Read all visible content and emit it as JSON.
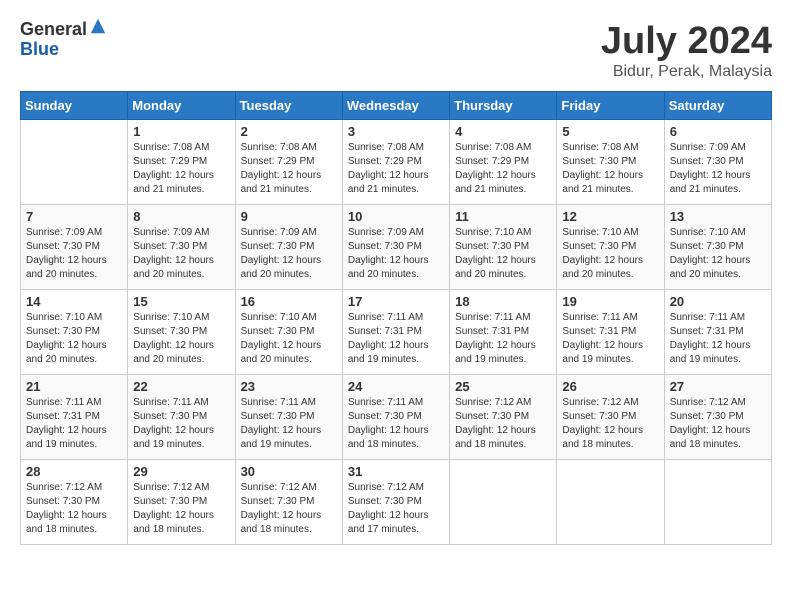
{
  "header": {
    "logo": {
      "general": "General",
      "blue": "Blue"
    },
    "title": "July 2024",
    "subtitle": "Bidur, Perak, Malaysia"
  },
  "calendar": {
    "weekdays": [
      "Sunday",
      "Monday",
      "Tuesday",
      "Wednesday",
      "Thursday",
      "Friday",
      "Saturday"
    ],
    "weeks": [
      [
        {
          "day": "",
          "info": ""
        },
        {
          "day": "1",
          "info": "Sunrise: 7:08 AM\nSunset: 7:29 PM\nDaylight: 12 hours\nand 21 minutes."
        },
        {
          "day": "2",
          "info": "Sunrise: 7:08 AM\nSunset: 7:29 PM\nDaylight: 12 hours\nand 21 minutes."
        },
        {
          "day": "3",
          "info": "Sunrise: 7:08 AM\nSunset: 7:29 PM\nDaylight: 12 hours\nand 21 minutes."
        },
        {
          "day": "4",
          "info": "Sunrise: 7:08 AM\nSunset: 7:29 PM\nDaylight: 12 hours\nand 21 minutes."
        },
        {
          "day": "5",
          "info": "Sunrise: 7:08 AM\nSunset: 7:30 PM\nDaylight: 12 hours\nand 21 minutes."
        },
        {
          "day": "6",
          "info": "Sunrise: 7:09 AM\nSunset: 7:30 PM\nDaylight: 12 hours\nand 21 minutes."
        }
      ],
      [
        {
          "day": "7",
          "info": "Sunrise: 7:09 AM\nSunset: 7:30 PM\nDaylight: 12 hours\nand 20 minutes."
        },
        {
          "day": "8",
          "info": "Sunrise: 7:09 AM\nSunset: 7:30 PM\nDaylight: 12 hours\nand 20 minutes."
        },
        {
          "day": "9",
          "info": "Sunrise: 7:09 AM\nSunset: 7:30 PM\nDaylight: 12 hours\nand 20 minutes."
        },
        {
          "day": "10",
          "info": "Sunrise: 7:09 AM\nSunset: 7:30 PM\nDaylight: 12 hours\nand 20 minutes."
        },
        {
          "day": "11",
          "info": "Sunrise: 7:10 AM\nSunset: 7:30 PM\nDaylight: 12 hours\nand 20 minutes."
        },
        {
          "day": "12",
          "info": "Sunrise: 7:10 AM\nSunset: 7:30 PM\nDaylight: 12 hours\nand 20 minutes."
        },
        {
          "day": "13",
          "info": "Sunrise: 7:10 AM\nSunset: 7:30 PM\nDaylight: 12 hours\nand 20 minutes."
        }
      ],
      [
        {
          "day": "14",
          "info": "Sunrise: 7:10 AM\nSunset: 7:30 PM\nDaylight: 12 hours\nand 20 minutes."
        },
        {
          "day": "15",
          "info": "Sunrise: 7:10 AM\nSunset: 7:30 PM\nDaylight: 12 hours\nand 20 minutes."
        },
        {
          "day": "16",
          "info": "Sunrise: 7:10 AM\nSunset: 7:30 PM\nDaylight: 12 hours\nand 20 minutes."
        },
        {
          "day": "17",
          "info": "Sunrise: 7:11 AM\nSunset: 7:31 PM\nDaylight: 12 hours\nand 19 minutes."
        },
        {
          "day": "18",
          "info": "Sunrise: 7:11 AM\nSunset: 7:31 PM\nDaylight: 12 hours\nand 19 minutes."
        },
        {
          "day": "19",
          "info": "Sunrise: 7:11 AM\nSunset: 7:31 PM\nDaylight: 12 hours\nand 19 minutes."
        },
        {
          "day": "20",
          "info": "Sunrise: 7:11 AM\nSunset: 7:31 PM\nDaylight: 12 hours\nand 19 minutes."
        }
      ],
      [
        {
          "day": "21",
          "info": "Sunrise: 7:11 AM\nSunset: 7:31 PM\nDaylight: 12 hours\nand 19 minutes."
        },
        {
          "day": "22",
          "info": "Sunrise: 7:11 AM\nSunset: 7:30 PM\nDaylight: 12 hours\nand 19 minutes."
        },
        {
          "day": "23",
          "info": "Sunrise: 7:11 AM\nSunset: 7:30 PM\nDaylight: 12 hours\nand 19 minutes."
        },
        {
          "day": "24",
          "info": "Sunrise: 7:11 AM\nSunset: 7:30 PM\nDaylight: 12 hours\nand 18 minutes."
        },
        {
          "day": "25",
          "info": "Sunrise: 7:12 AM\nSunset: 7:30 PM\nDaylight: 12 hours\nand 18 minutes."
        },
        {
          "day": "26",
          "info": "Sunrise: 7:12 AM\nSunset: 7:30 PM\nDaylight: 12 hours\nand 18 minutes."
        },
        {
          "day": "27",
          "info": "Sunrise: 7:12 AM\nSunset: 7:30 PM\nDaylight: 12 hours\nand 18 minutes."
        }
      ],
      [
        {
          "day": "28",
          "info": "Sunrise: 7:12 AM\nSunset: 7:30 PM\nDaylight: 12 hours\nand 18 minutes."
        },
        {
          "day": "29",
          "info": "Sunrise: 7:12 AM\nSunset: 7:30 PM\nDaylight: 12 hours\nand 18 minutes."
        },
        {
          "day": "30",
          "info": "Sunrise: 7:12 AM\nSunset: 7:30 PM\nDaylight: 12 hours\nand 18 minutes."
        },
        {
          "day": "31",
          "info": "Sunrise: 7:12 AM\nSunset: 7:30 PM\nDaylight: 12 hours\nand 17 minutes."
        },
        {
          "day": "",
          "info": ""
        },
        {
          "day": "",
          "info": ""
        },
        {
          "day": "",
          "info": ""
        }
      ]
    ]
  }
}
